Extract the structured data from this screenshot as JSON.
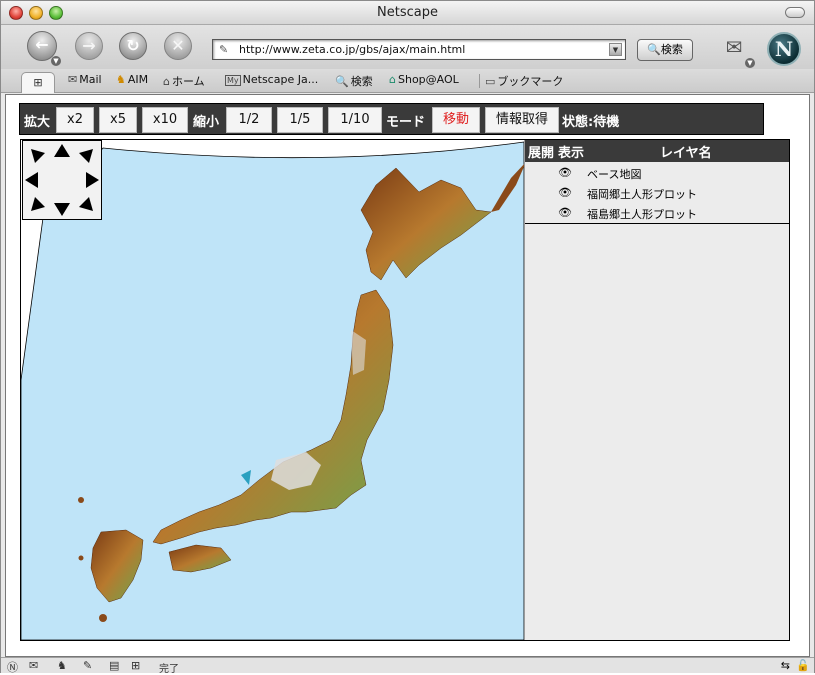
{
  "window": {
    "title": "Netscape"
  },
  "toolbar": {
    "url": "http://www.zeta.co.jp/gbs/ajax/main.html",
    "search_label": "検索"
  },
  "personal_bar": {
    "items": [
      {
        "label": "Mail",
        "icon": "mail-icon"
      },
      {
        "label": "AIM",
        "icon": "aim-icon"
      },
      {
        "label": "ホーム",
        "icon": "home-icon"
      },
      {
        "label": "Netscape Ja...",
        "icon": "my-netscape-icon"
      },
      {
        "label": "検索",
        "icon": "search-icon"
      },
      {
        "label": "Shop@AOL",
        "icon": "shop-icon"
      },
      {
        "label": "ブックマーク",
        "icon": "folder-icon"
      }
    ]
  },
  "controls": {
    "zoom_in_label": "拡大",
    "zoom_in_buttons": [
      "x2",
      "x5",
      "x10"
    ],
    "zoom_out_label": "縮小",
    "zoom_out_buttons": [
      "1/2",
      "1/5",
      "1/10"
    ],
    "mode_label": "モード",
    "move_button": "移動",
    "info_button": "情報取得",
    "status_text": "状態:待機",
    "accent": "#e02020"
  },
  "layers": {
    "headers": {
      "expand": "展開",
      "show": "表示",
      "name": "レイヤ名"
    },
    "items": [
      {
        "name": "ベース地図",
        "visible": true
      },
      {
        "name": "福岡郷土人形プロット",
        "visible": true
      },
      {
        "name": "福島郷土人形プロット",
        "visible": true
      }
    ]
  },
  "status": {
    "text": "完了"
  },
  "colors": {
    "sea": "#bfe4f8",
    "land_low": "#6aa84f",
    "land_mid": "#b7792e",
    "land_high": "#7a3b14",
    "peak": "#dedede"
  }
}
